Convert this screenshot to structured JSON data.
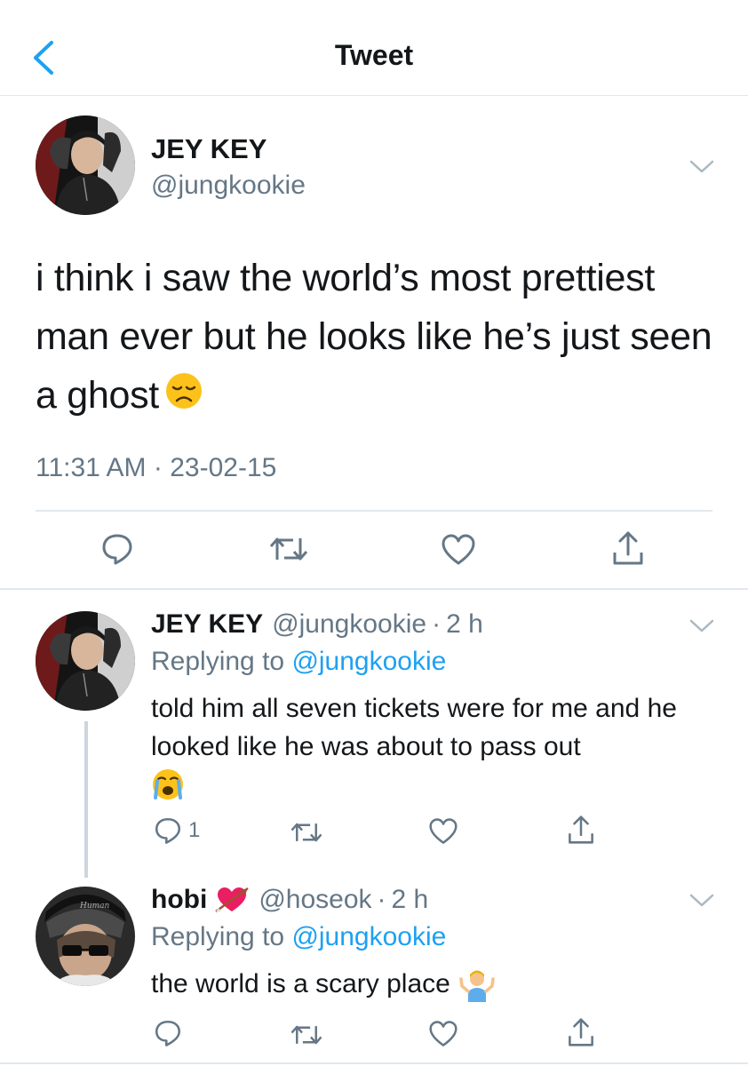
{
  "header": {
    "title": "Tweet"
  },
  "main_tweet": {
    "author_name": "JEY KEY",
    "handle": "@jungkookie",
    "text": "i think i saw the world’s most prettiest man ever but he looks like he’s just seen a ghost",
    "emoji": "disappointed-face",
    "time": "11:31 AM",
    "dot": "·",
    "date": "23-02-15"
  },
  "replies": [
    {
      "author_name": "JEY KEY",
      "handle": "@jungkookie",
      "dot": "·",
      "time": "2 h",
      "replying_prefix": "Replying to ",
      "replying_to": "@jungkookie",
      "text": "told him all seven tickets were for me and he looked like he was about to pass out",
      "emoji": "loudly-crying-face",
      "reply_count": "1"
    },
    {
      "author_name": "hobi",
      "name_emoji": "heart-with-arrow",
      "handle": "@hoseok",
      "dot": "·",
      "time": "2 h",
      "replying_prefix": "Replying to ",
      "replying_to": "@jungkookie",
      "text": "the world is a scary place",
      "emoji": "person-shrugging",
      "reply_count": ""
    }
  ],
  "colors": {
    "accent": "#1da1f2",
    "secondary_text": "#657786",
    "divider": "#e1e8ed",
    "icon": "#657786"
  }
}
